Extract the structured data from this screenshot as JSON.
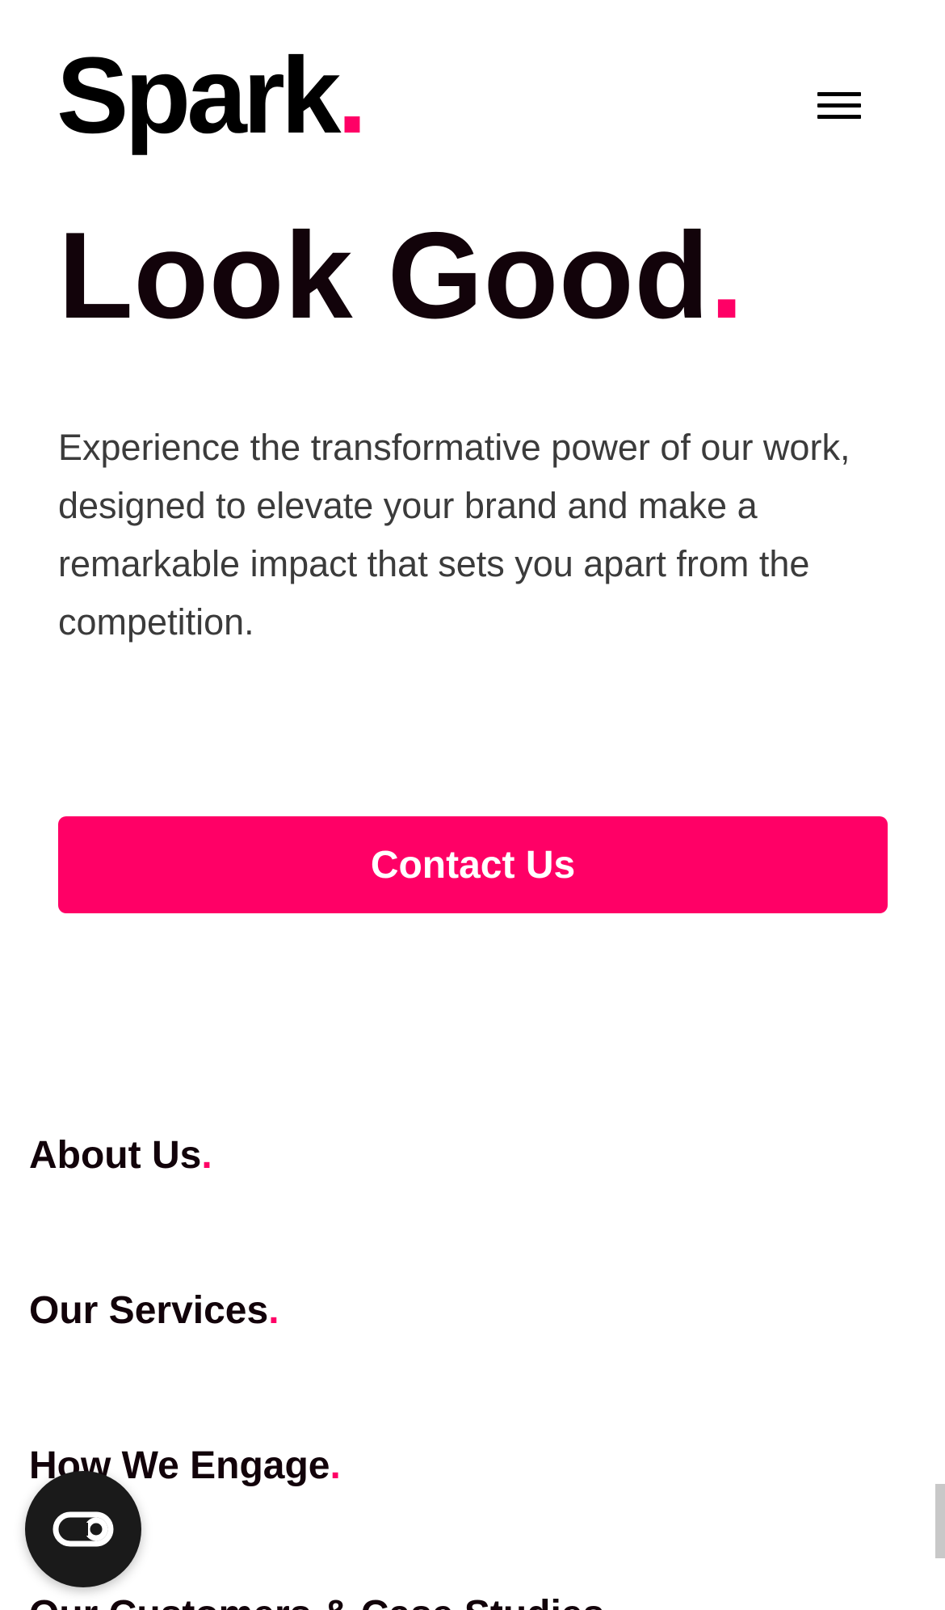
{
  "header": {
    "logo_text": "Spark",
    "logo_dot": ".",
    "menu_icon": "hamburger-menu-icon"
  },
  "hero": {
    "title": "Look Good",
    "title_dot": ".",
    "description": "Experience the transformative power of our work, designed to elevate your brand and make a remarkable impact that sets you apart from the competition.",
    "cta_label": "Contact Us"
  },
  "nav": {
    "items": [
      {
        "label": "About Us",
        "dot": "."
      },
      {
        "label": "Our Services",
        "dot": "."
      },
      {
        "label": "How We Engage",
        "dot": "."
      },
      {
        "label": "Our Customers & Case Studies",
        "dot": "."
      }
    ]
  },
  "widget": {
    "icon": "accessibility-toggle-icon"
  },
  "colors": {
    "accent": "#ff0066",
    "text_dark": "#12030a",
    "text_body": "#3b3b3b",
    "background": "#ffffff",
    "widget_bg": "#1a1a1a"
  }
}
